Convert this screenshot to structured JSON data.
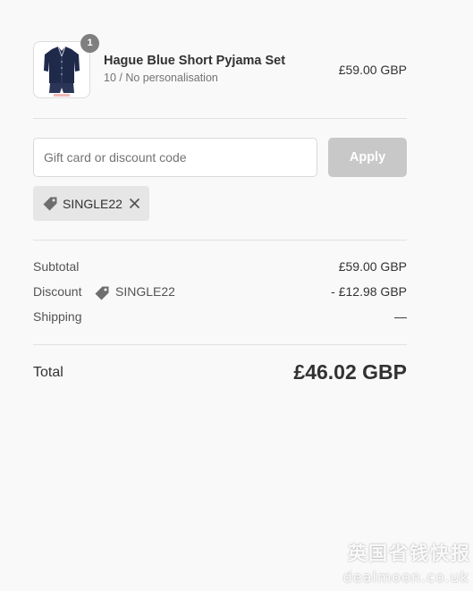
{
  "order": {
    "item": {
      "quantity": "1",
      "name": "Hague Blue Short Pyjama Set",
      "variant": "10 / No personalisation",
      "price": "£59.00 GBP",
      "image_icon": "navy-pyjama-set-thumbnail"
    }
  },
  "discount_form": {
    "placeholder": "Gift card or discount code",
    "value": "",
    "apply_label": "Apply"
  },
  "applied_code": {
    "code": "SINGLE22",
    "tag_icon": "price-tag-icon",
    "remove_icon": "close-icon"
  },
  "summary": {
    "subtotal_label": "Subtotal",
    "subtotal_value": "£59.00 GBP",
    "discount_label": "Discount",
    "discount_code": "SINGLE22",
    "discount_value": "- £12.98 GBP",
    "shipping_label": "Shipping",
    "shipping_value": "—",
    "total_label": "Total",
    "total_value": "£46.02 GBP"
  },
  "watermark": {
    "text": "英国省钱快报",
    "url": "dealmoon.co.uk"
  },
  "colors": {
    "background": "#f9f9f9",
    "apply_button": "#c8c8c8",
    "tag_background": "#e6e6e6",
    "badge": "#7f7f7f",
    "pyjama_navy": "#1f2a4a"
  }
}
